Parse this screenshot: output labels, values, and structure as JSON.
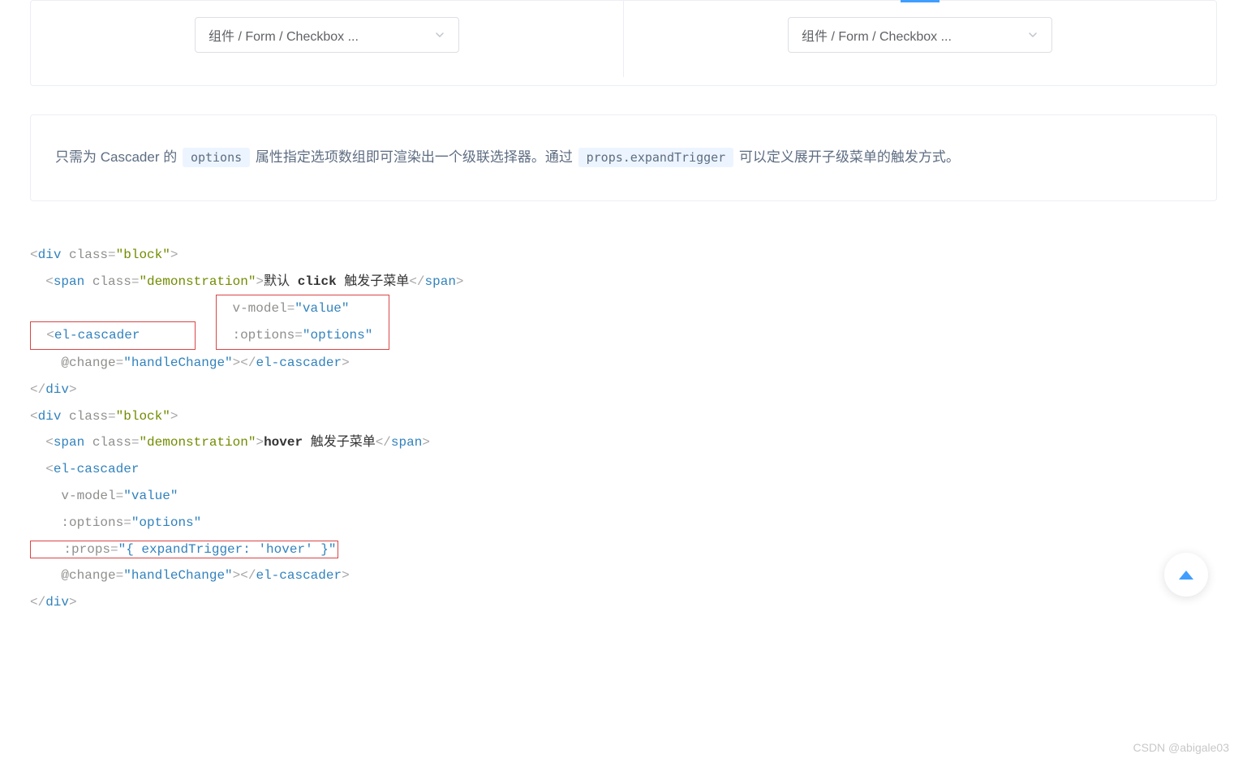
{
  "demo": {
    "cascader1": {
      "text": "组件 / Form / Checkbox ..."
    },
    "cascader2": {
      "text": "组件 / Form / Checkbox ..."
    }
  },
  "description": {
    "part1": "只需为 Cascader 的 ",
    "code1": "options",
    "part2": " 属性指定选项数组即可渲染出一个级联选择器。通过 ",
    "code2": "props.expandTrigger",
    "part3": " 可以定义展开子级菜单的触发方式。"
  },
  "code": {
    "line1_open": "<",
    "line1_tag": "div",
    "line1_attr": " class",
    "line1_eq": "=",
    "line1_val": "\"block\"",
    "line1_close": ">",
    "line2_open": "  <",
    "line2_tag": "span",
    "line2_attr": " class",
    "line2_val": "\"demonstration\"",
    "line2_close": ">",
    "line2_text1": "默认 ",
    "line2_text2": "click",
    "line2_text3": " 触发子菜单",
    "line2_endopen": "</",
    "line2_endclose": ">",
    "line3_open": "  <",
    "line3_tag": "el-cascader",
    "line4_attr": "    v-model",
    "line4_val": "\"value\"",
    "line5_attr": "    :options",
    "line5_val": "\"options\"",
    "line6_attr": "    @change",
    "line6_val": "\"handleChange\"",
    "line6_close": ">",
    "line6_endopen": "</",
    "line6_endtag": "el-cascader",
    "line6_endclose": ">",
    "line7_open": "</",
    "line7_tag": "div",
    "line7_close": ">",
    "line8_open": "<",
    "line8_tag": "div",
    "line8_attr": " class",
    "line8_val": "\"block\"",
    "line8_close": ">",
    "line9_open": "  <",
    "line9_tag": "span",
    "line9_attr": " class",
    "line9_val": "\"demonstration\"",
    "line9_close": ">",
    "line9_text1": "hover",
    "line9_text2": " 触发子菜单",
    "line9_endopen": "</",
    "line9_endclose": ">",
    "line10_open": "  <",
    "line10_tag": "el-cascader",
    "line11_attr": "    v-model",
    "line11_val": "\"value\"",
    "line12_attr": "    :options",
    "line12_val": "\"options\"",
    "line13_attr": "    :props",
    "line13_val": "\"{ expandTrigger: 'hover' }\"",
    "line14_attr": "    @change",
    "line14_val": "\"handleChange\"",
    "line14_close": ">",
    "line14_endopen": "</",
    "line14_endtag": "el-cascader",
    "line14_endclose": ">",
    "line15_open": "</",
    "line15_tag": "div",
    "line15_close": ">"
  },
  "watermark": "CSDN @abigale03"
}
